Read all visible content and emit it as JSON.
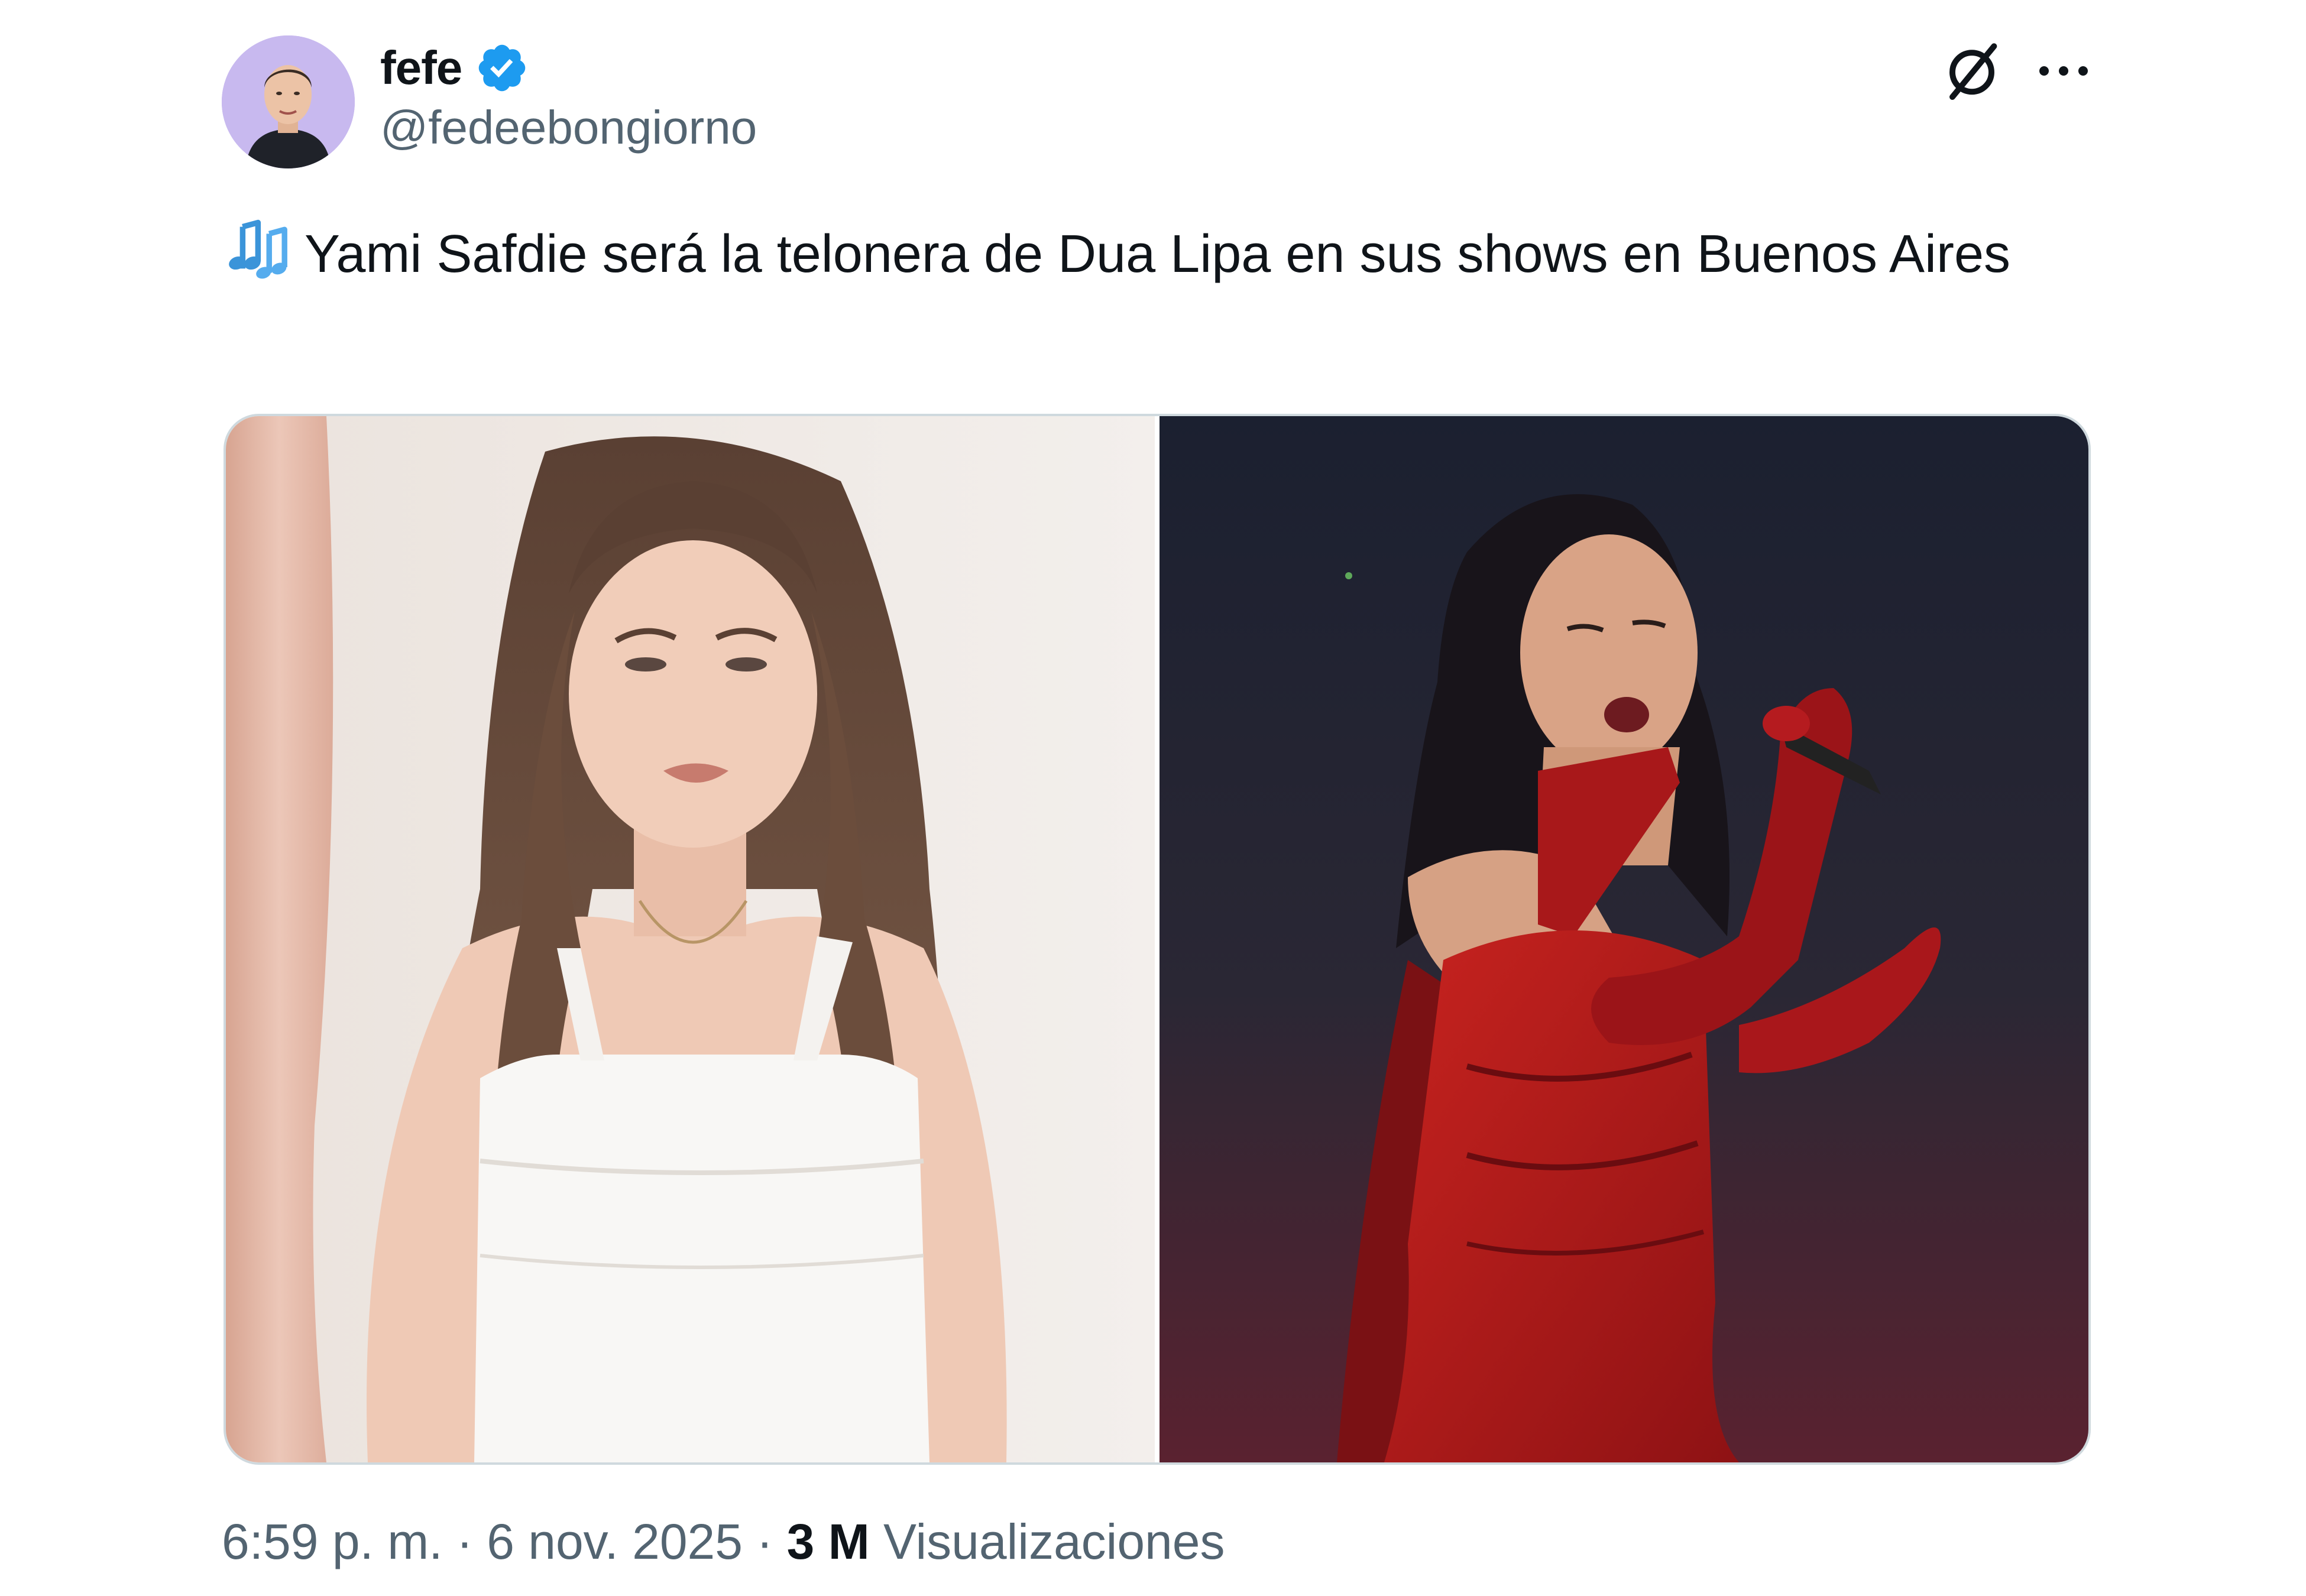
{
  "author": {
    "name": "fefe",
    "handle": "@fedeebongiorno",
    "verified": true,
    "verified_color": "#1d9bf0",
    "avatar_icon": "avatar-photo"
  },
  "header_actions": {
    "grok_icon": "grok-icon",
    "more_icon": "more-icon"
  },
  "tweet": {
    "emoji": "musical-notes-icon",
    "text": "Yami Safdie será la telonera de Dua Lipa en sus shows en Buenos Aires"
  },
  "media": {
    "count": 2,
    "images": [
      {
        "name": "yami-safdie-photo"
      },
      {
        "name": "dua-lipa-photo"
      }
    ]
  },
  "meta": {
    "time": "6:59 p. m.",
    "separator": " · ",
    "date": "6 nov. 2025",
    "views_count": "3 M",
    "views_label": " Visualizaciones"
  },
  "colors": {
    "text_primary": "#0f1419",
    "text_secondary": "#536471",
    "border": "#cfd9de",
    "accent": "#1d9bf0"
  }
}
